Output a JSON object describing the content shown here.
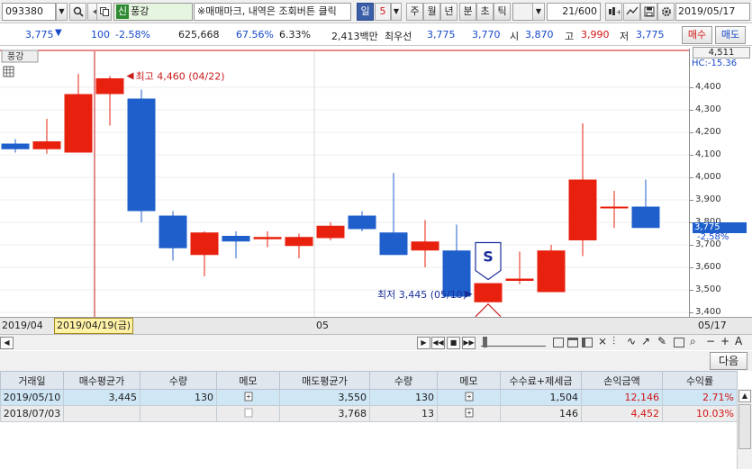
{
  "toolbar": {
    "code": "093380",
    "stock_badge": "신",
    "stock_name": "풍강",
    "hint": "※매매마크, 내역은 조회버튼 클릭",
    "period_selected": "일",
    "period_n": "5",
    "periods": [
      "주",
      "월",
      "년",
      "분",
      "초",
      "틱"
    ],
    "count": "21/600",
    "date": "2019/05/17"
  },
  "quote": {
    "price": "3,775",
    "change": "100",
    "change_pct": "-2.58%",
    "volume": "625,668",
    "vol_ratio": "67.56%",
    "turnover": "6.33%",
    "amount": "2,413백만",
    "best_label": "최우선",
    "best_ask": "3,775",
    "best_bid": "3,770",
    "open_label": "시",
    "open": "3,870",
    "high_label": "고",
    "high": "3,990",
    "low_label": "저",
    "low": "3,775",
    "buy_label": "매수",
    "sell_label": "매도"
  },
  "chart_header": {
    "name": "풍강",
    "high_label": "최고 4,460 (04/22)",
    "low_label": "최저 3,445 (05/10)",
    "sell_marker": "S",
    "top_value": "4,511",
    "hc_label": "HC:-15.36",
    "current_price": "3,775",
    "current_pct": "-2.58%"
  },
  "price_ticks": [
    "4,400",
    "4,300",
    "4,200",
    "4,100",
    "4,000",
    "3,900",
    "3,800",
    "3,700",
    "3,600",
    "3,500",
    "3,400"
  ],
  "date_axis": {
    "left": "2019/04",
    "cursor": "2019/04/19(금)",
    "mid": "05",
    "right": "05/17"
  },
  "chart_data": {
    "type": "candlestick",
    "ylim": [
      3380,
      4560
    ],
    "candles": [
      {
        "o": 4150,
        "h": 4170,
        "l": 4110,
        "c": 4125
      },
      {
        "o": 4125,
        "h": 4260,
        "l": 4105,
        "c": 4160
      },
      {
        "o": 4110,
        "h": 4460,
        "l": 4110,
        "c": 4370
      },
      {
        "o": 4370,
        "h": 4450,
        "l": 4230,
        "c": 4440
      },
      {
        "o": 4350,
        "h": 4390,
        "l": 3800,
        "c": 3850
      },
      {
        "o": 3830,
        "h": 3850,
        "l": 3630,
        "c": 3685
      },
      {
        "o": 3655,
        "h": 3760,
        "l": 3560,
        "c": 3755
      },
      {
        "o": 3740,
        "h": 3760,
        "l": 3640,
        "c": 3715
      },
      {
        "o": 3725,
        "h": 3760,
        "l": 3690,
        "c": 3735
      },
      {
        "o": 3695,
        "h": 3750,
        "l": 3640,
        "c": 3735
      },
      {
        "o": 3730,
        "h": 3800,
        "l": 3720,
        "c": 3785
      },
      {
        "o": 3830,
        "h": 3850,
        "l": 3760,
        "c": 3770
      },
      {
        "o": 3755,
        "h": 4020,
        "l": 3655,
        "c": 3655
      },
      {
        "o": 3675,
        "h": 3810,
        "l": 3600,
        "c": 3715
      },
      {
        "o": 3675,
        "h": 3790,
        "l": 3465,
        "c": 3470
      },
      {
        "o": 3445,
        "h": 3530,
        "l": 3445,
        "c": 3530
      },
      {
        "o": 3540,
        "h": 3670,
        "l": 3525,
        "c": 3550
      },
      {
        "o": 3490,
        "h": 3700,
        "l": 3490,
        "c": 3675
      },
      {
        "o": 3720,
        "h": 4240,
        "l": 3650,
        "c": 3990
      },
      {
        "o": 3870,
        "h": 3940,
        "l": 3775,
        "c": 3870
      },
      {
        "o": 3870,
        "h": 3990,
        "l": 3775,
        "c": 3775
      }
    ]
  },
  "trades": {
    "headers": [
      "거래일",
      "매수평균가",
      "수량",
      "메모",
      "매도평균가",
      "수량",
      "메모",
      "수수료+제세금",
      "손익금액",
      "수익률"
    ],
    "rows": [
      {
        "date": "2019/05/10",
        "buy_avg": "3,445",
        "buy_qty": "130",
        "sell_avg": "3,550",
        "sell_qty": "130",
        "fee": "1,504",
        "pnl": "12,146",
        "ret": "2.71%"
      },
      {
        "date": "2018/07/03",
        "buy_avg": "",
        "buy_qty": "",
        "sell_avg": "3,768",
        "sell_qty": "13",
        "fee": "146",
        "pnl": "4,452",
        "ret": "10.03%"
      }
    ],
    "next_label": "다음"
  },
  "colors": {
    "up": "#e8200e",
    "down": "#1f5fcc",
    "highlight": "#cfe6f5"
  }
}
